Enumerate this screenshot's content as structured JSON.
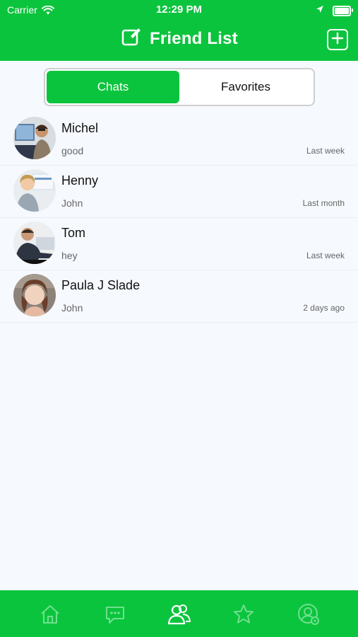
{
  "status_bar": {
    "carrier": "Carrier",
    "time": "12:29 PM",
    "battery_level": 0.9
  },
  "header": {
    "title": "Friend List",
    "edit_icon": "edit-icon",
    "add_icon": "plus-square-icon"
  },
  "segmented": {
    "tabs": [
      {
        "label": "Chats",
        "active": true
      },
      {
        "label": "Favorites",
        "active": false
      }
    ]
  },
  "chats": [
    {
      "name": "Michel",
      "message": "good",
      "time": "Last week"
    },
    {
      "name": "Henny",
      "message": "John",
      "time": "Last month"
    },
    {
      "name": "Tom",
      "message": "hey",
      "time": "Last week"
    },
    {
      "name": "Paula J Slade",
      "message": "John",
      "time": "2 days ago"
    }
  ],
  "tab_bar": {
    "items": [
      {
        "icon": "home-icon",
        "active": false
      },
      {
        "icon": "chat-bubble-icon",
        "active": false
      },
      {
        "icon": "friends-icon",
        "active": true
      },
      {
        "icon": "star-icon",
        "active": false
      },
      {
        "icon": "profile-settings-icon",
        "active": false
      }
    ]
  },
  "colors": {
    "brand_green": "#0bc43d",
    "background": "#f6f9fe",
    "secondary_text": "#666666"
  }
}
